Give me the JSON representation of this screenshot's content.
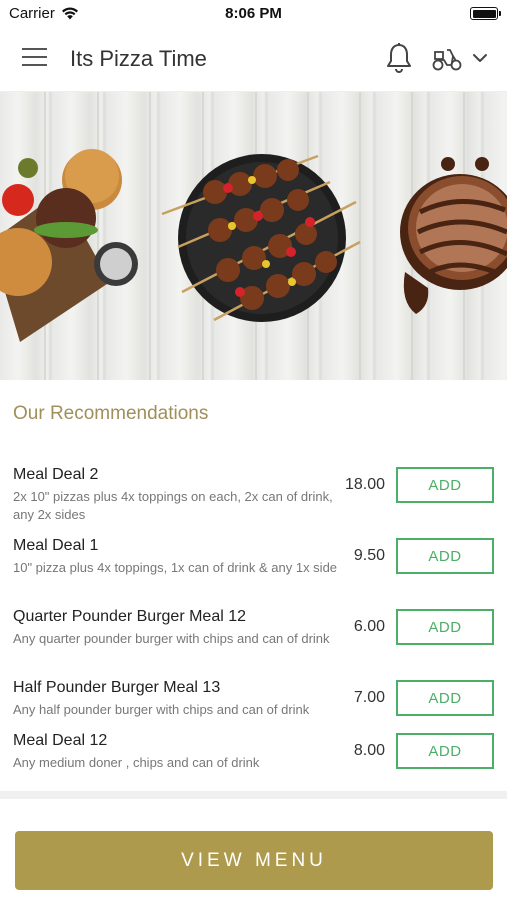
{
  "status_bar": {
    "carrier": "Carrier",
    "time": "8:06 PM"
  },
  "header": {
    "title": "Its Pizza Time",
    "icons": [
      "menu-icon",
      "bell-icon",
      "scooter-icon",
      "chevron-down-icon"
    ]
  },
  "banner": {
    "images": [
      "burger-board-image",
      "kebab-skewers-image",
      "chocolate-cake-image"
    ]
  },
  "recommendations": {
    "title": "Our Recommendations",
    "add_label": "ADD",
    "items": [
      {
        "name": "Meal Deal 2",
        "description": "2x 10\" pizzas plus 4x toppings on each, 2x can of drink, any 2x sides",
        "price": "18.00"
      },
      {
        "name": "Meal Deal 1",
        "description": "10\" pizza plus 4x toppings, 1x can of drink & any 1x side",
        "price": "9.50"
      },
      {
        "name": "Quarter Pounder Burger Meal 12",
        "description": "Any quarter pounder burger with chips and can of drink",
        "price": "6.00"
      },
      {
        "name": "Half Pounder Burger Meal 13",
        "description": "Any half pounder burger with chips and can of drink",
        "price": "7.00"
      },
      {
        "name": "Meal Deal 12",
        "description": "Any medium doner , chips and can of drink",
        "price": "8.00"
      }
    ]
  },
  "footer": {
    "view_menu_label": "VIEW MENU"
  },
  "colors": {
    "accent_gold": "#ad9a4c",
    "heading_gold": "#a08f5a",
    "add_green": "#4caf67"
  }
}
